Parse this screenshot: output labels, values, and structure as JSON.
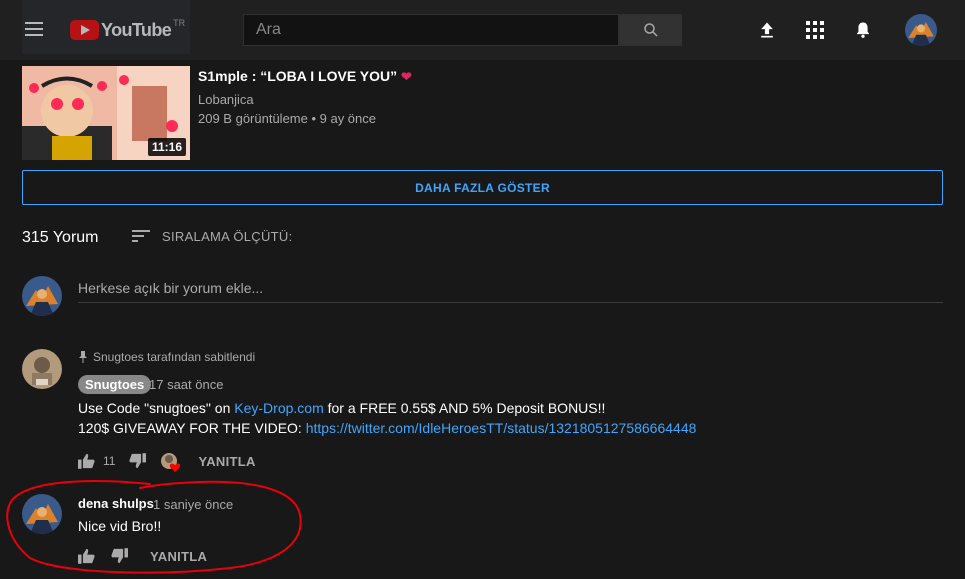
{
  "masthead": {
    "logo_text": "YouTube",
    "region": "TR",
    "search_placeholder": "Ara",
    "icons": [
      "menu-icon",
      "search-icon",
      "upload-icon",
      "apps-icon",
      "notifications-icon"
    ]
  },
  "video": {
    "title": "S1mple : “LOBA I LOVE YOU”",
    "title_emoji": "❤",
    "channel": "Lobanjica",
    "stats": "209 B görüntüleme • 9 ay önce",
    "duration": "11:16"
  },
  "show_more_label": "DAHA FAZLA GÖSTER",
  "comments": {
    "count_label": "315 Yorum",
    "sort_label": "SIRALAMA ÖLÇÜTÜ:",
    "add_placeholder": "Herkese açık bir yorum ekle...",
    "items": [
      {
        "pinned_text": "Snugtoes tarafından sabitlendi",
        "author": "Snugtoes",
        "time": "17 saat önce",
        "line1_prefix": "Use Code \"snugtoes\"  on ",
        "line1_link": "Key-Drop.com",
        "line1_suffix": " for a FREE 0.55$ AND 5% Deposit BONUS!!",
        "line2_prefix": "120$ GIVEAWAY FOR THE VIDEO: ",
        "line2_link": "https://twitter.com/IdleHeroesTT/status/1321805127586664448",
        "likes": "11",
        "reply_label": "YANITLA"
      },
      {
        "author": "dena shulps",
        "time": "1 saniye önce",
        "text": "Nice vid Bro!!",
        "reply_label": "YANITLA"
      }
    ]
  },
  "colors": {
    "background": "#181818",
    "masthead": "#202020",
    "accent_blue": "#3ea6ff",
    "youtube_red": "#ff0000",
    "annotation_red": "#e8000b"
  }
}
